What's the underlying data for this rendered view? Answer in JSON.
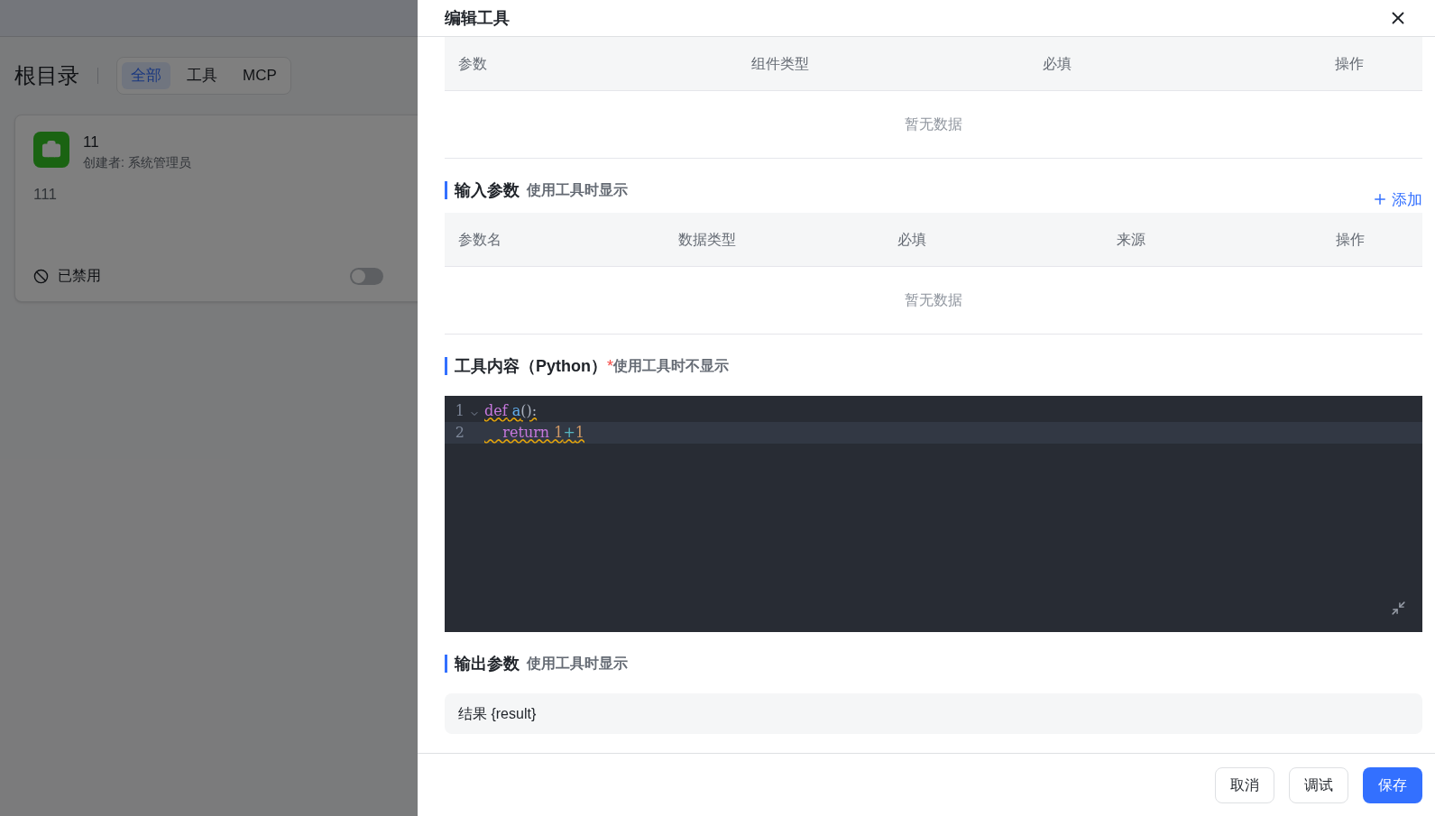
{
  "page": {
    "title": "根目录",
    "filters": [
      {
        "label": "全部",
        "selected": true
      },
      {
        "label": "工具",
        "selected": false
      },
      {
        "label": "MCP",
        "selected": false
      }
    ],
    "card": {
      "name": "11",
      "creator": "创建者: 系统管理员",
      "description": "111",
      "status": "已禁用",
      "enabled": false
    }
  },
  "drawer": {
    "title": "编辑工具",
    "init_table": {
      "columns": [
        "参数",
        "组件类型",
        "必填",
        "操作"
      ],
      "empty": "暂无数据"
    },
    "input_section": {
      "title": "输入参数",
      "hint": "使用工具时显示",
      "add": "添加"
    },
    "input_table": {
      "columns": [
        "参数名",
        "数据类型",
        "必填",
        "来源",
        "操作"
      ],
      "empty": "暂无数据"
    },
    "code_section": {
      "title": "工具内容（Python）",
      "required": "*",
      "hint": "使用工具时不显示"
    },
    "code": [
      {
        "number": "1",
        "foldable": true,
        "active": false,
        "tokens": [
          {
            "kind": "keyword",
            "text": "def"
          },
          {
            "kind": "name",
            "text": " a"
          },
          {
            "kind": "punct",
            "text": "():"
          }
        ]
      },
      {
        "number": "2",
        "foldable": false,
        "active": true,
        "tokens": [
          {
            "kind": "keyword",
            "text": "    return"
          },
          {
            "kind": "number",
            "text": " 1"
          },
          {
            "kind": "operator",
            "text": "+"
          },
          {
            "kind": "number",
            "text": "1"
          }
        ]
      }
    ],
    "output_section": {
      "title": "输出参数",
      "hint": "使用工具时显示",
      "value": "结果 {result}"
    },
    "buttons": [
      {
        "label": "取消",
        "kind": "default"
      },
      {
        "label": "调试",
        "kind": "default"
      },
      {
        "label": "保存",
        "kind": "primary"
      }
    ]
  }
}
